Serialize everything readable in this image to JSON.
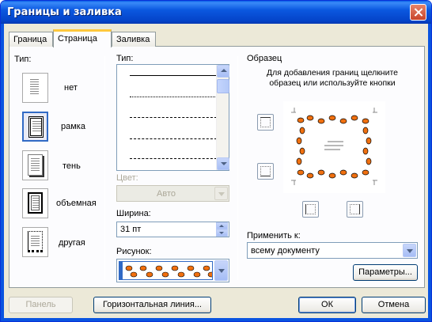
{
  "window": {
    "title": "Границы и заливка"
  },
  "tabs": [
    "Граница",
    "Страница",
    "Заливка"
  ],
  "left": {
    "heading": "Тип:",
    "types": [
      "нет",
      "рамка",
      "тень",
      "объемная",
      "другая"
    ],
    "selected": "рамка"
  },
  "middle": {
    "style_label": "Тип:",
    "color_label": "Цвет:",
    "color_value": "Авто",
    "width_label": "Ширина:",
    "width_value": "31 пт",
    "art_label": "Рисунок:"
  },
  "right": {
    "heading": "Образец",
    "hint": "Для добавления границ щелкните образец или используйте кнопки",
    "apply_label": "Применить к:",
    "apply_value": "всему документу",
    "options_button": "Параметры..."
  },
  "footer": {
    "panel_button": "Панель",
    "hline_button": "Горизонтальная линия...",
    "ok": "ОК",
    "cancel": "Отмена"
  },
  "icons": [
    "close-icon",
    "border-top-icon",
    "border-bottom-icon",
    "border-left-icon",
    "border-right-icon"
  ],
  "colors": {
    "accent": "#316ac5",
    "title_bar": "#0a5ee8",
    "tab_highlight": "#ffc83c"
  }
}
